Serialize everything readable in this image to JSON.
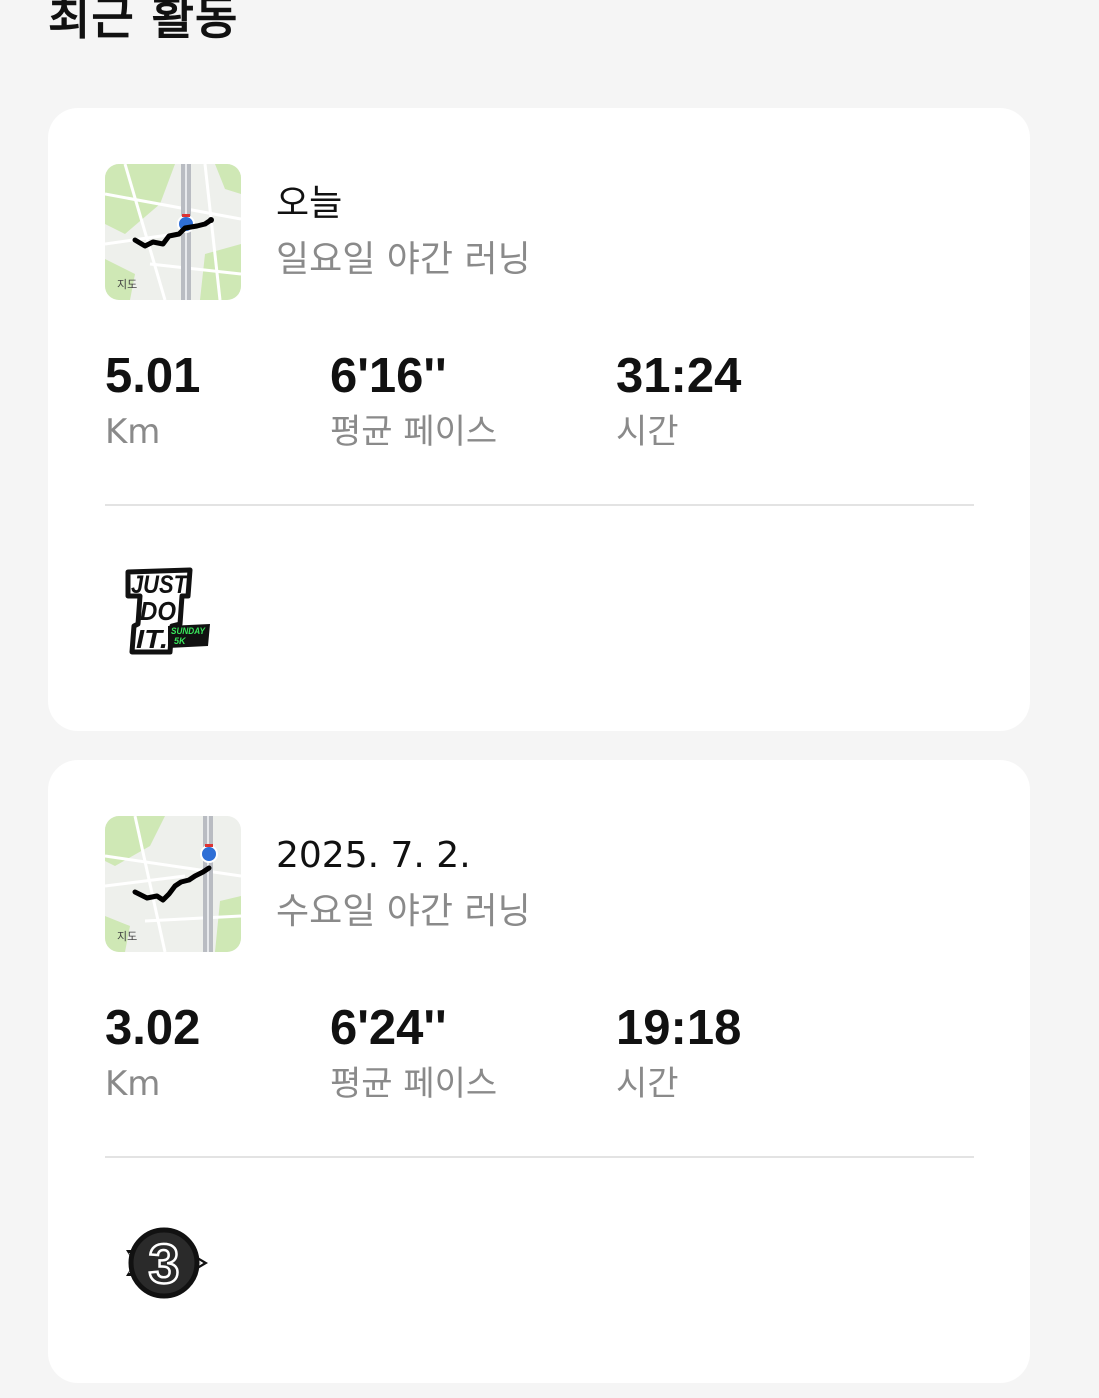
{
  "section": {
    "title": "최근 활동"
  },
  "activities": [
    {
      "date": "오늘",
      "name": "일요일 야간 러닝",
      "map": {
        "watermark": "지도",
        "route_color": "#000000"
      },
      "stats": [
        {
          "value": "5.01",
          "label": "Km"
        },
        {
          "value": "6'16''",
          "label": "평균 페이스"
        },
        {
          "value": "31:24",
          "label": "시간"
        }
      ],
      "badge": {
        "icon": "just-do-it-sunday-5k-badge",
        "lines": [
          "JUST",
          "DO",
          "IT."
        ],
        "tag_lines": [
          "SUNDAY",
          "5K"
        ]
      }
    },
    {
      "date": "2025. 7. 2.",
      "name": "수요일 야간 러닝",
      "map": {
        "watermark": "지도",
        "route_color": "#000000"
      },
      "stats": [
        {
          "value": "3.02",
          "label": "Km"
        },
        {
          "value": "6'24''",
          "label": "평균 페이스"
        },
        {
          "value": "19:18",
          "label": "시간"
        }
      ],
      "badge": {
        "icon": "3k-arrow-badge",
        "number": "3"
      }
    }
  ],
  "colors": {
    "background": "#f5f5f5",
    "card": "#ffffff",
    "text_primary": "#111111",
    "text_secondary": "#8a8a8a",
    "badge_accent_green": "#39e65c",
    "map_green": "#cfe8b5",
    "map_highway_blue": "#2f6fd6"
  }
}
